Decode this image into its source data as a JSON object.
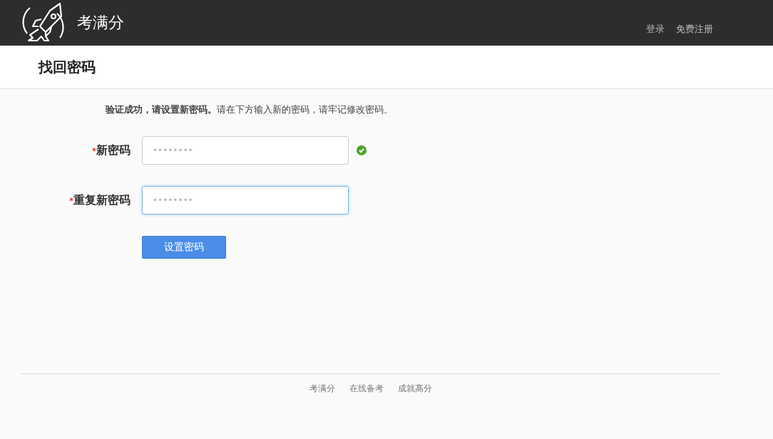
{
  "header": {
    "brand": "考满分",
    "links": [
      {
        "label": "登录"
      },
      {
        "label": "免费注册"
      }
    ]
  },
  "page_title": "找回密码",
  "message": "**验证成功，请设置新密码。**请在下方输入新的密码，请牢记修改密码。",
  "fields": [
    {
      "required_mark": "*",
      "label": "新密码",
      "value": "••••••••",
      "valid": true,
      "focused": false
    },
    {
      "required_mark": "*",
      "label": "重复新密码",
      "value": "••••••••",
      "valid": false,
      "focused": true
    }
  ],
  "submit_button": "设置密码",
  "footer_links": [
    {
      "label": "考满分"
    },
    {
      "label": "在线备考"
    },
    {
      "label": "成就高分"
    }
  ]
}
